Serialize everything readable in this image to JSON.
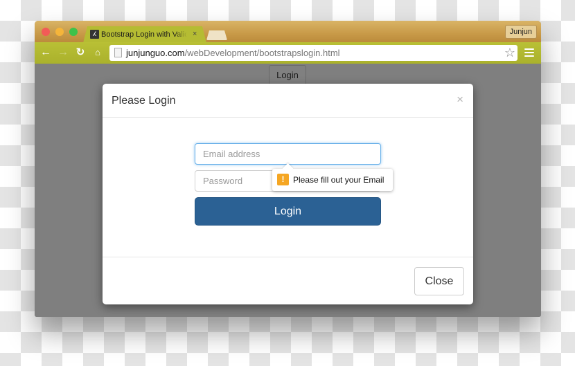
{
  "browser": {
    "tab": {
      "favicon": "bootstrap-favicon",
      "favicon_glyph": "ⵃ",
      "title": "Bootstrap Login with Validation",
      "close_glyph": "×"
    },
    "profile_name": "Junjun",
    "nav": {
      "back_glyph": "←",
      "forward_glyph": "→",
      "reload_glyph": "↻",
      "home_glyph": "⌂"
    },
    "url": {
      "domain": "junjunguo.com",
      "path": "/webDevelopment/bootstrapslogin.html"
    },
    "star_glyph": "☆"
  },
  "page": {
    "open_modal_button": "Login"
  },
  "modal": {
    "title": "Please Login",
    "close_x": "×",
    "email_placeholder": "Email address",
    "email_value": "",
    "password_placeholder": "Password",
    "password_value": "",
    "submit_label": "Login",
    "validation_tooltip": {
      "icon_glyph": "!",
      "message": "Please fill out your Email"
    },
    "footer_close_label": "Close"
  },
  "colors": {
    "primary_button": "#2b6194",
    "focus_border": "#66afe9",
    "warning": "#f5a623",
    "toolbar": "#b5bc33",
    "titlebar": "#c89a48",
    "backdrop": "#7f7f7f"
  }
}
